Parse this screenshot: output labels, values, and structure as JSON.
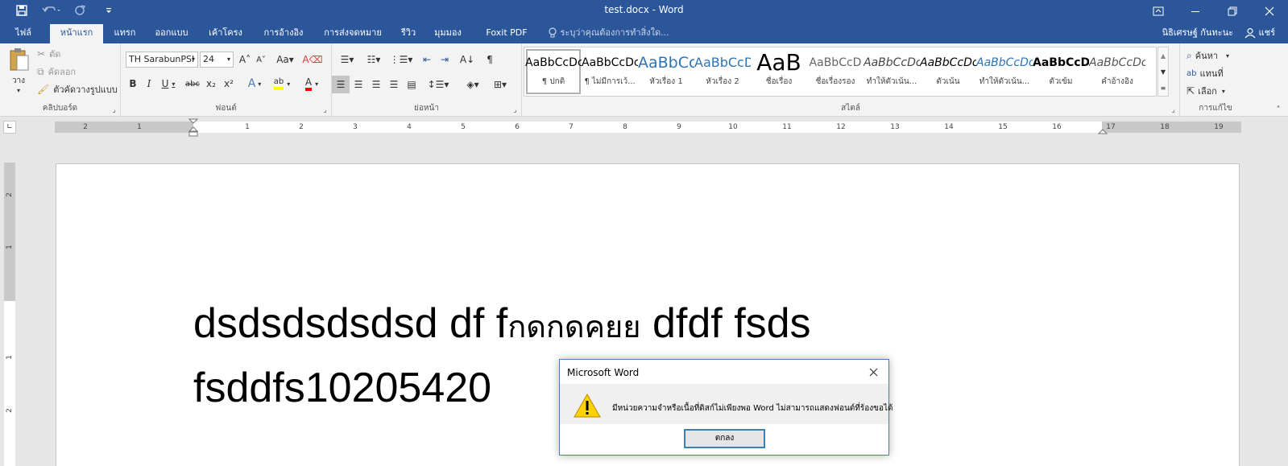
{
  "window": {
    "title": "test.docx - Word",
    "controls": [
      "ribbon-options",
      "minimize",
      "restore",
      "close"
    ]
  },
  "tabs": [
    {
      "label": "ไฟล์",
      "active": false
    },
    {
      "label": "หน้าแรก",
      "active": true
    },
    {
      "label": "แทรก",
      "active": false
    },
    {
      "label": "ออกแบบ",
      "active": false
    },
    {
      "label": "เค้าโครง",
      "active": false
    },
    {
      "label": "การอ้างอิง",
      "active": false
    },
    {
      "label": "การส่งจดหมาย",
      "active": false
    },
    {
      "label": "รีวิว",
      "active": false
    },
    {
      "label": "มุมมอง",
      "active": false
    },
    {
      "label": "Foxit PDF",
      "active": false
    }
  ],
  "tellme": "ระบุว่าคุณต้องการทำสิ่งใด...",
  "user": {
    "name": "นิธิเศรษฐ์ กันทะนะ",
    "share": "แชร์"
  },
  "clipboard": {
    "paste": "วาง",
    "cut": "ตัด",
    "copy": "คัดลอก",
    "format_painter": "ตัวคัดวางรูปแบบ",
    "label": "คลิปบอร์ด"
  },
  "font": {
    "name": "TH SarabunPSI",
    "size": "24",
    "label": "ฟอนต์",
    "highlight_color": "#ffff00",
    "font_color": "#ff0000"
  },
  "paragraph": {
    "label": "ย่อหน้า"
  },
  "styles": {
    "label": "สไตล์",
    "items": [
      {
        "preview": "AaBbCcDc",
        "name": "¶ ปกติ"
      },
      {
        "preview": "AaBbCcDc",
        "name": "¶ ไม่มีการเว้..."
      },
      {
        "preview": "AaBbCc",
        "name": "หัวเรื่อง 1"
      },
      {
        "preview": "AaBbCcD",
        "name": "หัวเรื่อง 2"
      },
      {
        "preview": "AaB",
        "name": "ชื่อเรื่อง"
      },
      {
        "preview": "AaBbCcD",
        "name": "ชื่อเรื่องรอง"
      },
      {
        "preview": "AaBbCcDc",
        "name": "ทำให้ตัวเน้น..."
      },
      {
        "preview": "AaBbCcDc",
        "name": "ตัวเน้น"
      },
      {
        "preview": "AaBbCcDc",
        "name": "ทำให้ตัวเน้น..."
      },
      {
        "preview": "AaBbCcDc",
        "name": "ตัวเข้ม"
      },
      {
        "preview": "AaBbCcDc",
        "name": "คำอ้างอิง"
      }
    ]
  },
  "editing": {
    "find": "ค้นหา",
    "replace": "แทนที่",
    "select": "เลือก",
    "label": "การแก้ไข"
  },
  "ruler": {
    "labels": [
      "2",
      "1",
      "1",
      "2",
      "3",
      "4",
      "5",
      "6",
      "7",
      "8",
      "9",
      "10",
      "11",
      "12",
      "13",
      "14",
      "15",
      "16",
      "17",
      "18",
      "19"
    ],
    "vertical_labels": [
      "2",
      "1",
      "1",
      "2"
    ]
  },
  "document": {
    "line1_latin": "dsdsdsdsdsd df f",
    "line1_thai": "กดกดคยย",
    "line1_tail": " dfdf fsds",
    "line2": "fsddfs10205420"
  },
  "dialog": {
    "title": "Microsoft Word",
    "message": "มีหน่วยความจำหรือเนื้อที่ดิสก์ไม่เพียงพอ  Word ไม่สามารถแสดงฟอนต์ที่ร้องขอได้",
    "ok": "ตกลง"
  }
}
